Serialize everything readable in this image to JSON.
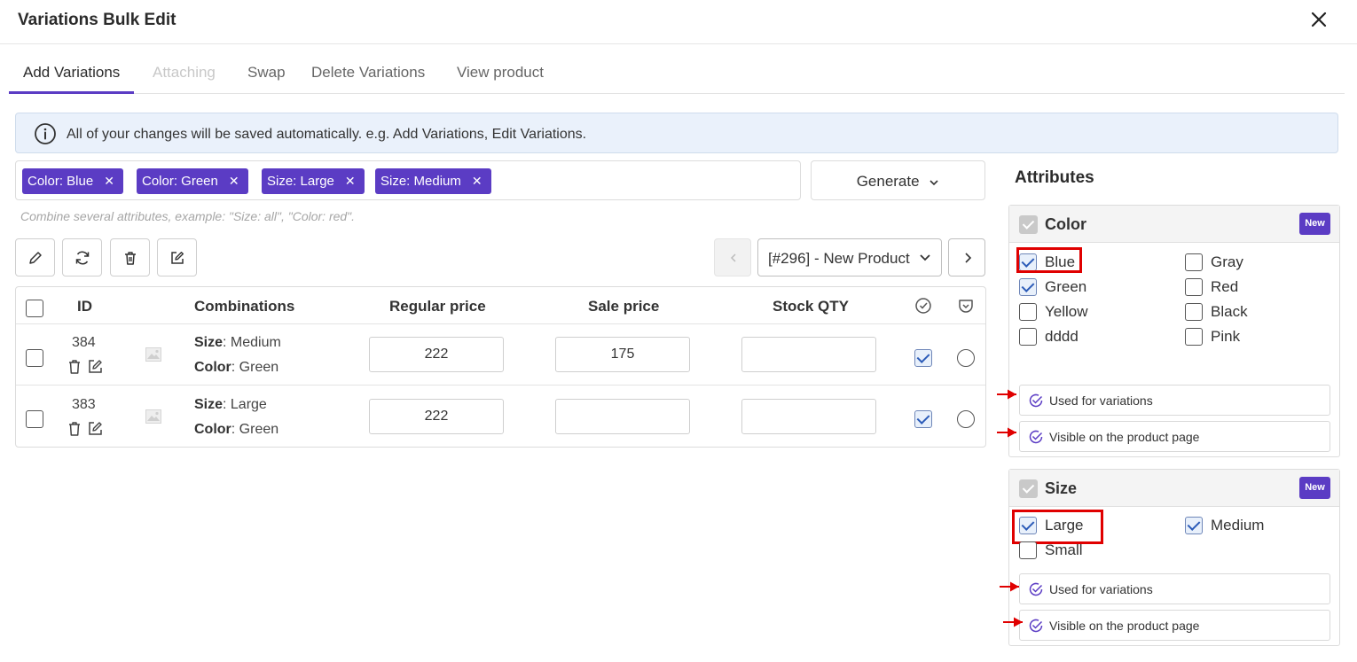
{
  "modal": {
    "title": "Variations Bulk Edit"
  },
  "tabs": [
    {
      "label": "Add Variations",
      "state": "active"
    },
    {
      "label": "Attaching",
      "state": "disabled"
    },
    {
      "label": "Swap",
      "state": "normal"
    },
    {
      "label": "Delete Variations",
      "state": "normal"
    },
    {
      "label": "View product",
      "state": "normal"
    }
  ],
  "notice": {
    "text": "All of your changes will be saved automatically. e.g. Add Variations, Edit Variations."
  },
  "tags": [
    {
      "label": "Color: Blue"
    },
    {
      "label": "Color: Green"
    },
    {
      "label": "Size: Large"
    },
    {
      "label": "Size: Medium"
    }
  ],
  "generate": {
    "label": "Generate"
  },
  "hint": "Combine several attributes, example: \"Size: all\", \"Color: red\".",
  "product_select": {
    "value": "[#296] - New Product"
  },
  "table": {
    "headers": {
      "id": "ID",
      "combinations": "Combinations",
      "regular_price": "Regular price",
      "sale_price": "Sale price",
      "stock_qty": "Stock QTY"
    },
    "rows": [
      {
        "id": "384",
        "attr1_name": "Size",
        "attr1_value": ": Medium",
        "attr2_name": "Color",
        "attr2_value": ": Green",
        "regular_price": "222",
        "sale_price": "175",
        "stock_qty": "",
        "enabled": true,
        "default": false
      },
      {
        "id": "383",
        "attr1_name": "Size",
        "attr1_value": ": Large",
        "attr2_name": "Color",
        "attr2_value": ": Green",
        "regular_price": "222",
        "sale_price": "",
        "stock_qty": "",
        "enabled": true,
        "default": false
      }
    ]
  },
  "attributes": {
    "title": "Attributes",
    "color": {
      "name": "Color",
      "badge": "New",
      "options": [
        {
          "label": "Blue",
          "checked": true
        },
        {
          "label": "Gray",
          "checked": false
        },
        {
          "label": "Green",
          "checked": true
        },
        {
          "label": "Red",
          "checked": false
        },
        {
          "label": "Yellow",
          "checked": false
        },
        {
          "label": "Black",
          "checked": false
        },
        {
          "label": "dddd",
          "checked": false
        },
        {
          "label": "Pink",
          "checked": false
        }
      ],
      "used_for_variations": "Used for variations",
      "visible_on_page": "Visible on the product page"
    },
    "size": {
      "name": "Size",
      "badge": "New",
      "options": [
        {
          "label": "Large",
          "checked": true
        },
        {
          "label": "Medium",
          "checked": true
        },
        {
          "label": "Small",
          "checked": false
        }
      ],
      "used_for_variations": "Used for variations",
      "visible_on_page": "Visible on the product page"
    }
  },
  "colors": {
    "accent": "#5b3cc4",
    "annotation": "#e00000"
  }
}
